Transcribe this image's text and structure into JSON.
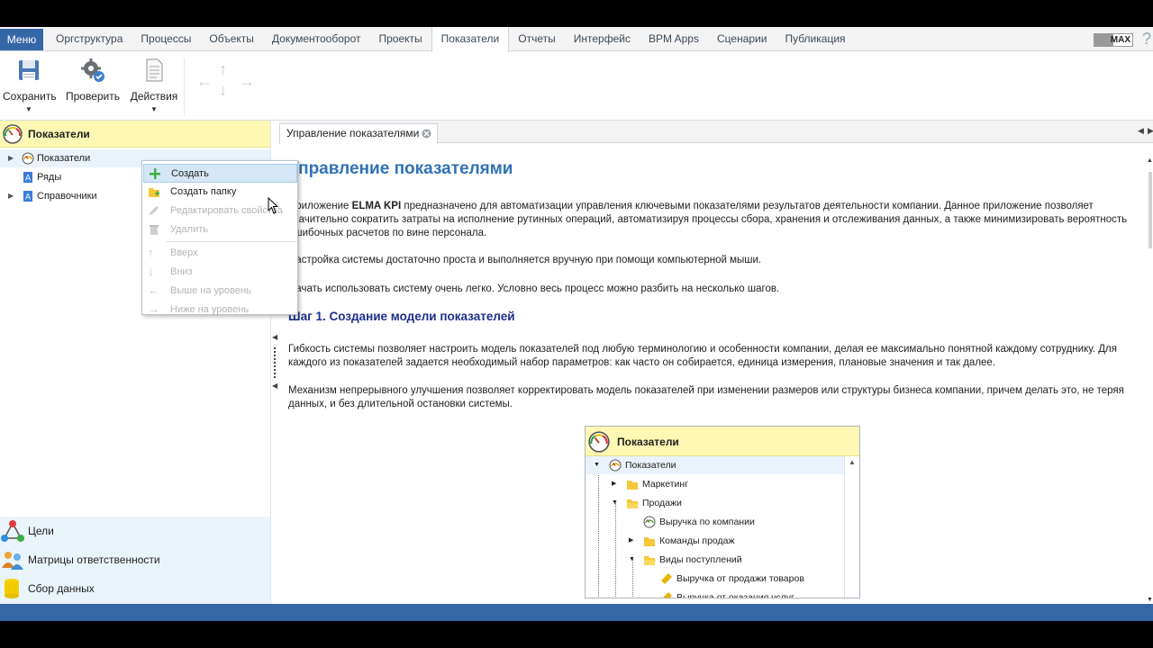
{
  "menubar": {
    "menu_label": "Меню",
    "items": [
      "Оргструктура",
      "Процессы",
      "Объекты",
      "Документооборот",
      "Проекты",
      "Показатели",
      "Отчеты",
      "Интерфейс",
      "BPM Apps",
      "Сценарии",
      "Публикация"
    ],
    "active_index": 5,
    "max_label": "MAX"
  },
  "toolbar": {
    "save_label": "Сохранить",
    "check_label": "Проверить",
    "actions_label": "Действия"
  },
  "left_panel": {
    "header_title": "Показатели",
    "tree": [
      {
        "label": "Показатели",
        "expandable": true,
        "selected": true,
        "icon": "gauge-icon"
      },
      {
        "label": "Ряды",
        "expandable": false,
        "selected": false,
        "icon": "series-icon"
      },
      {
        "label": "Справочники",
        "expandable": true,
        "selected": false,
        "icon": "dictionary-icon"
      }
    ],
    "bottom_nav": [
      {
        "label": "Цели",
        "icon": "goals-icon"
      },
      {
        "label": "Матрицы ответственности",
        "icon": "responsibility-matrix-icon"
      },
      {
        "label": "Сбор данных",
        "icon": "data-collection-icon"
      }
    ]
  },
  "context_menu": {
    "items": [
      {
        "label": "Создать",
        "icon": "plus-icon",
        "enabled": true,
        "hover": true
      },
      {
        "label": "Создать папку",
        "icon": "folder-add-icon",
        "enabled": true,
        "hover": false
      },
      {
        "label": "Редактировать свойства",
        "icon": "pencil-icon",
        "enabled": false,
        "hover": false
      },
      {
        "label": "Удалить",
        "icon": "trash-icon",
        "enabled": false,
        "hover": false
      },
      {
        "label": "Вверх",
        "icon": "arrow-up-icon",
        "enabled": false,
        "hover": false
      },
      {
        "label": "Вниз",
        "icon": "arrow-down-icon",
        "enabled": false,
        "hover": false
      },
      {
        "label": "Выше на уровень",
        "icon": "arrow-left-icon",
        "enabled": false,
        "hover": false
      },
      {
        "label": "Ниже на уровень",
        "icon": "arrow-right-icon",
        "enabled": false,
        "hover": false
      }
    ]
  },
  "content": {
    "tab_label": "Управление показателями",
    "heading": "Управление показателями",
    "para1_bold": "ELMA KPI",
    "para1_pre": "Приложение ",
    "para1_post": " предназначено для автоматизации управления ключевыми показателями результатов деятельности компании. Данное приложение позволяет значительно сократить затраты на исполнение рутинных операций, автоматизируя процессы сбора, хранения и отслеживания данных, а также минимизировать вероятность ошибочных расчетов по вине персонала.",
    "para2": "Настройка системы достаточно проста и выполняется вручную при помощи компьютерной мыши.",
    "para3": "Начать использовать систему очень легко. Условно весь процесс можно разбить на несколько шагов.",
    "step1_heading": "Шаг 1. Создание модели показателей",
    "para4": "Гибкость системы позволяет настроить модель показателей под любую терминологию и особенности компании, делая ее максимально понятной каждому сотруднику. Для каждого из показателей задается необходимый набор параметров: как часто он собирается, единица измерения, плановые значения и так далее.",
    "para5": "Механизм непрерывного улучшения позволяет корректировать модель показателей при изменении размеров или структуры бизнеса компании, причем делать это, не теряя данных, и без длительной остановки системы."
  },
  "embedded": {
    "header_title": "Показатели",
    "rows": [
      {
        "label": "Показатели",
        "level": 0,
        "icon": "gauge-icon",
        "selected": true
      },
      {
        "label": "Маркетинг",
        "level": 1,
        "icon": "folder-icon",
        "selected": false
      },
      {
        "label": "Продажи",
        "level": 1,
        "icon": "folder-open-icon",
        "selected": false
      },
      {
        "label": "Выручка по компании",
        "level": 2,
        "icon": "gauge-icon",
        "selected": false
      },
      {
        "label": "Команды продаж",
        "level": 2,
        "icon": "folder-icon",
        "selected": false
      },
      {
        "label": "Виды поступлений",
        "level": 2,
        "icon": "folder-open-icon",
        "selected": false
      },
      {
        "label": "Выручка от продажи товаров",
        "level": 3,
        "icon": "ruler-icon",
        "selected": false
      },
      {
        "label": "Выручка от оказания услуг",
        "level": 3,
        "icon": "ruler-icon",
        "selected": false
      }
    ]
  },
  "colors": {
    "accent": "#3566a8",
    "header_yellow": "#fdf8b3",
    "heading_blue": "#2f72b5",
    "step_heading": "#1c2f8c"
  }
}
